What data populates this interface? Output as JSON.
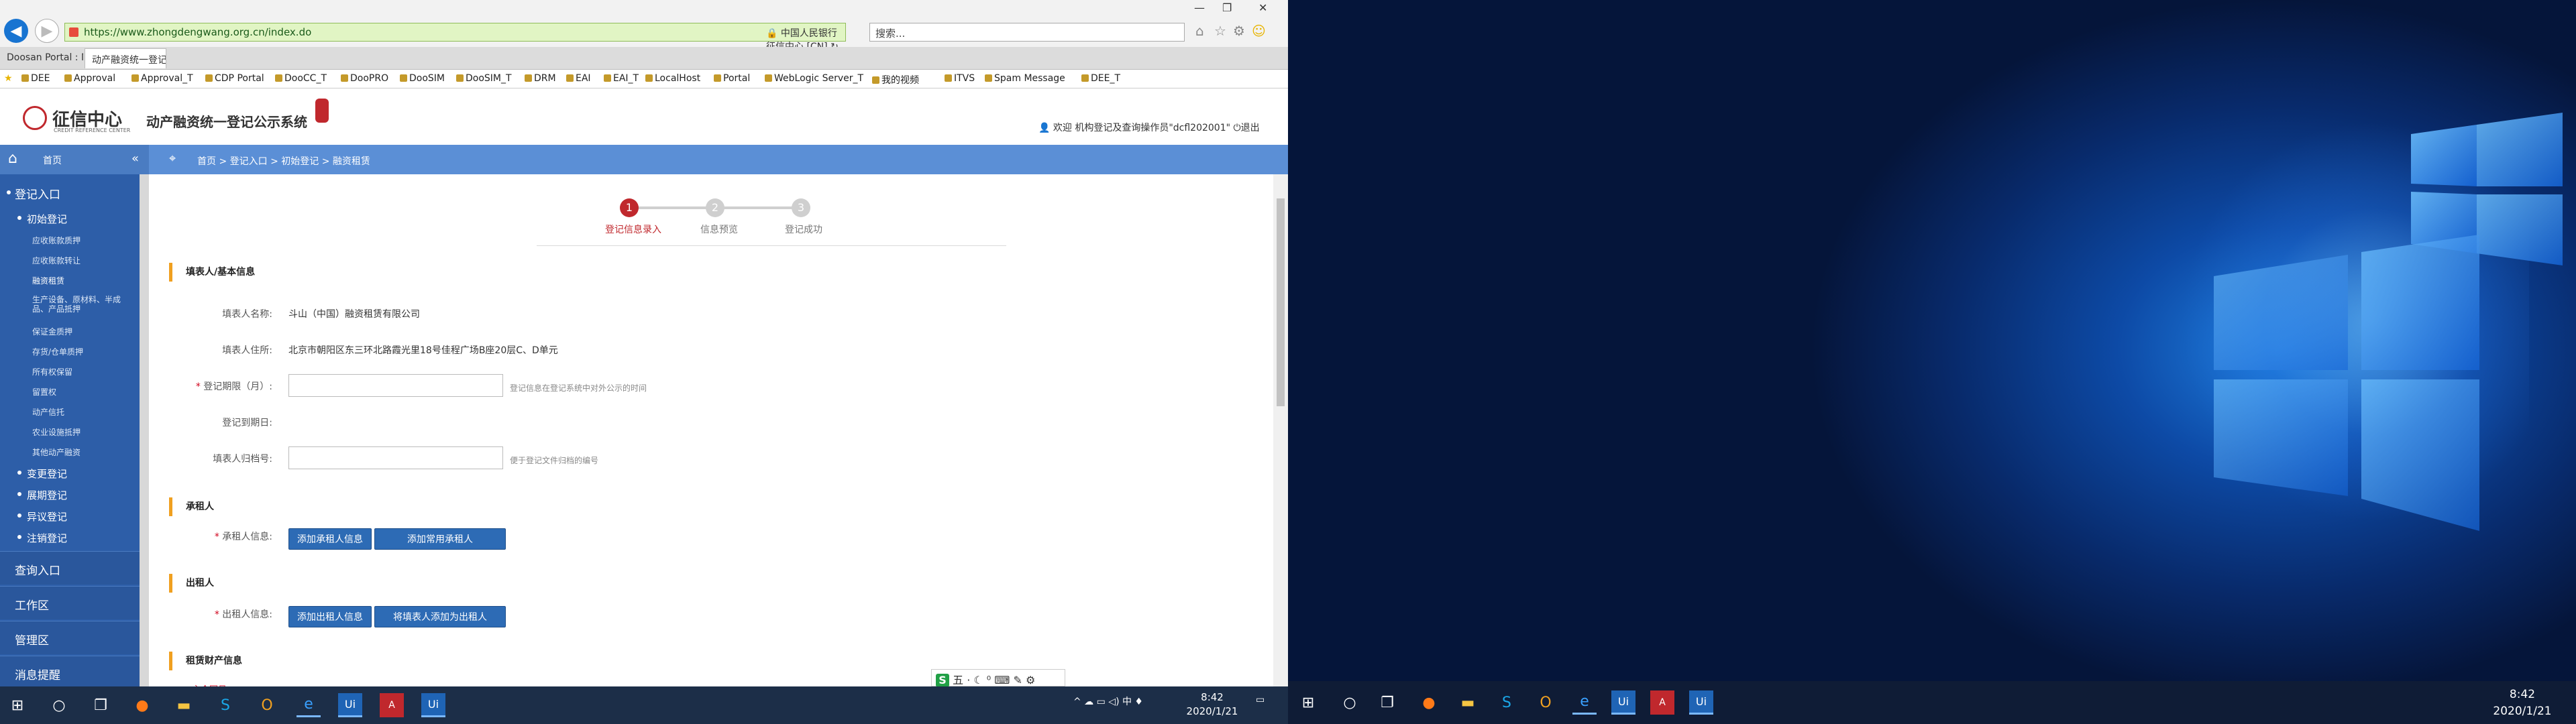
{
  "browser": {
    "url": "https://www.zhongdengwang.org.cn/index.do",
    "site_identity": "中国人民银行征信中心 [CN]",
    "search_placeholder": "搜索...",
    "tabs": [
      {
        "label": "Doosan Portal : My workpla..."
      },
      {
        "label": "动产融资统一登记公示系统",
        "active": true
      },
      {
        "label": ""
      }
    ],
    "favorites": [
      "DEE",
      "Approval",
      "Approval_T",
      "CDP Portal",
      "DooCC_T",
      "DooPRO",
      "DooSIM",
      "DooSIM_T",
      "DRM",
      "EAI",
      "EAI_T",
      "LocalHost",
      "Portal",
      "WebLogic Server_T",
      "我的视频",
      "ITVS",
      "Spam Message",
      "DEE_T"
    ]
  },
  "app": {
    "logo_title": "征信中心",
    "logo_subtitle": "CREDIT REFERENCE CENTER",
    "system_name": "动产融资统一登记公示系统",
    "user_info": "欢迎 机构登记及查询操作员\"dcfl202001\"",
    "logout": "退出",
    "home": "首页",
    "breadcrumb": "首页 > 登记入口 > 初始登记 > 融资租赁"
  },
  "sidebar": {
    "sections": [
      {
        "label": "登记入口"
      },
      {
        "label": "初始登记"
      },
      {
        "label": "应收账款质押"
      },
      {
        "label": "应收账款转让"
      },
      {
        "label": "融资租赁"
      },
      {
        "label": "生产设备、原材料、半成品、产品抵押"
      },
      {
        "label": "保证金质押"
      },
      {
        "label": "存货/仓单质押"
      },
      {
        "label": "所有权保留"
      },
      {
        "label": "留置权"
      },
      {
        "label": "动产信托"
      },
      {
        "label": "农业设施抵押"
      },
      {
        "label": "其他动产融资"
      },
      {
        "label": "变更登记"
      },
      {
        "label": "展期登记"
      },
      {
        "label": "异议登记"
      },
      {
        "label": "注销登记"
      }
    ],
    "bottom": [
      "查询入口",
      "工作区",
      "管理区",
      "消息提醒"
    ]
  },
  "steps": [
    {
      "num": "1",
      "label": "登记信息录入",
      "active": true
    },
    {
      "num": "2",
      "label": "信息预览",
      "active": false
    },
    {
      "num": "3",
      "label": "登记成功",
      "active": false
    }
  ],
  "form": {
    "section_filler": "填表人/基本信息",
    "filler_name_label": "填表人名称:",
    "filler_name_value": "斗山（中国）融资租赁有限公司",
    "filler_addr_label": "填表人住所:",
    "filler_addr_value": "北京市朝阳区东三环北路霞光里18号佳程广场B座20层C、D单元",
    "period_label": "登记期限（月）:",
    "period_hint": "登记信息在登记系统中对外公示的时间",
    "expiry_label": "登记到期日:",
    "archive_label": "填表人归档号:",
    "archive_hint": "便于登记文件归档的编号",
    "section_lessee": "承租人",
    "lessee_label": "承租人信息:",
    "btn_add_lessee": "添加承租人信息",
    "btn_add_common_lessee": "添加常用承租人",
    "section_lessor": "出租人",
    "lessor_label": "出租人信息:",
    "btn_add_lessor": "添加出租人信息",
    "btn_filler_as_lessor": "将填表人添加为出租人",
    "section_property": "租赁财产信息",
    "property_partial": "主合同号"
  },
  "ime": {
    "label": "五"
  },
  "taskbar_left": {
    "time": "8:42",
    "date": "2020/1/21"
  },
  "taskbar_right": {
    "time": "8:42",
    "date": "2020/1/21"
  },
  "colors": {
    "brand_red": "#c0282d",
    "sidebar_blue": "#2d5ea8",
    "crumb_blue": "#5b8fd6",
    "accent_orange": "#f0a020",
    "button_blue": "#2d6bb5"
  }
}
